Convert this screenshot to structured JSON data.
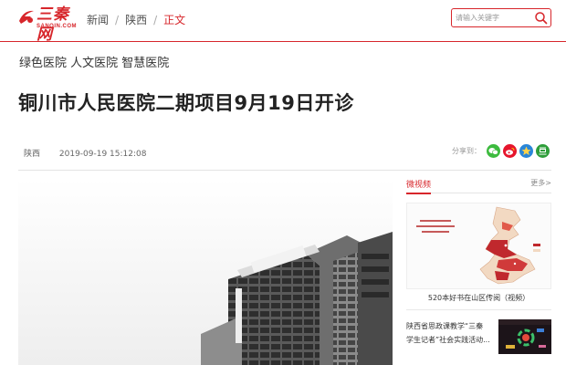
{
  "header": {
    "logo_text": "三秦网",
    "logo_sub": "SANQIN.COM",
    "breadcrumb": [
      "新闻",
      "陕西",
      "正文"
    ],
    "search_placeholder": "请输入关键字"
  },
  "article": {
    "tagline": "绿色医院 人文医院 智慧医院",
    "title": "铜川市人民医院二期项目9月19日开诊",
    "source": "陕西",
    "datetime": "2019-09-19 15:12:08",
    "share_label": "分享到："
  },
  "sidebar": {
    "section_title": "微视频",
    "more_label": "更多>",
    "video_caption": "520本好书在山区传阅（视频）",
    "news_text": "陕西省思政课教学“三秦学生记者”社会实践活动..."
  },
  "colors": {
    "brand": "#d7262b",
    "wechat": "#3dbb3f",
    "weibo": "#e6162d",
    "qzone": "#2a86d8",
    "douban": "#2e9e3a"
  },
  "icons": [
    "search-icon",
    "wechat-icon",
    "weibo-icon",
    "qzone-icon",
    "douban-icon"
  ]
}
